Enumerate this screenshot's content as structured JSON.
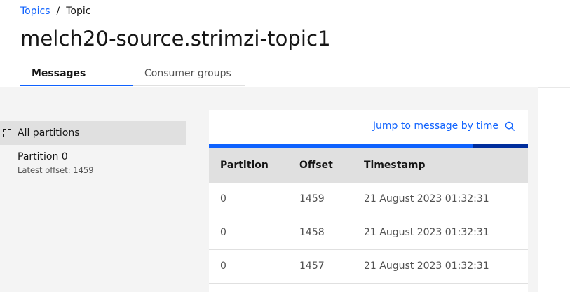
{
  "breadcrumb": {
    "parent": "Topics",
    "separator": "/",
    "current": "Topic"
  },
  "title": "melch20-source.strimzi-topic1",
  "tabs": [
    {
      "label": "Messages",
      "active": true
    },
    {
      "label": "Consumer groups",
      "active": false
    }
  ],
  "partitions": {
    "all_label": "All partitions",
    "items": [
      {
        "label": "Partition 0",
        "sub": "Latest offset: 1459"
      }
    ]
  },
  "messages": {
    "jump_label": "Jump to message by time",
    "progress_fraction": 0.828,
    "columns": [
      "Partition",
      "Offset",
      "Timestamp"
    ],
    "rows": [
      {
        "partition": "0",
        "offset": "1459",
        "timestamp": "21 August 2023 01:32:31"
      },
      {
        "partition": "0",
        "offset": "1458",
        "timestamp": "21 August 2023 01:32:31"
      },
      {
        "partition": "0",
        "offset": "1457",
        "timestamp": "21 August 2023 01:32:31"
      }
    ]
  },
  "colors": {
    "accent": "#0f62fe",
    "dark_accent": "#002d9c",
    "background": "#f4f4f4"
  },
  "icons": {
    "grid": "grid-icon",
    "search": "search-icon"
  }
}
